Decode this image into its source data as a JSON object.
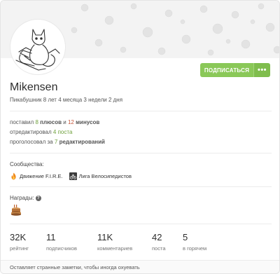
{
  "profile": {
    "username": "Mikensen",
    "since": "Пикабушник 8 лет 4 месяца 3 недели 2 дня",
    "subscribe_label": "ПОДПИСАТЬСЯ",
    "more_label": "•••"
  },
  "stats": {
    "line1_prefix": "поставил",
    "pluses_count": "8",
    "pluses_label": "плюсов",
    "and": "и",
    "minuses_count": "12",
    "minuses_label": "минусов",
    "line2_prefix": "отредактировал",
    "edits": "4 поста",
    "line3_prefix": "проголосовал",
    "line3_for": "за",
    "votes_count": "7",
    "votes_label": "редактирований"
  },
  "communities": {
    "label": "Сообщества:",
    "items": [
      {
        "name": "Движение F.I.R.E.",
        "icon": "flame-icon"
      },
      {
        "name": "Лига Велосипедистов",
        "icon": "bicycle-icon"
      }
    ]
  },
  "awards": {
    "label": "Награды:",
    "help": "?",
    "items": [
      {
        "icon": "cake-icon"
      }
    ]
  },
  "counters": [
    {
      "value": "32K",
      "label": "рейтинг"
    },
    {
      "value": "11",
      "label": "подписчиков"
    },
    {
      "value": "11K",
      "label": "комментариев"
    },
    {
      "value": "42",
      "label": "поста"
    },
    {
      "value": "5",
      "label": "в горячем"
    }
  ],
  "note": "Оставляет странные заметки, чтобы иногда охуевать",
  "colors": {
    "accent_green": "#8ac858",
    "plus_green": "#6ea03b",
    "minus_red": "#c5553a"
  }
}
